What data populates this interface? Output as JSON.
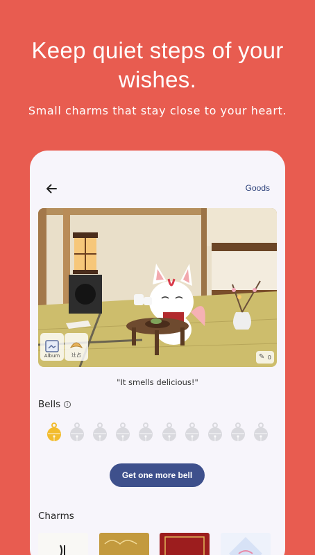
{
  "promo": {
    "headline_line1": "Keep quiet steps of your",
    "headline_line2": "wishes.",
    "subline": "Small charms that stay close to your heart."
  },
  "app": {
    "back_icon": "arrow-left-icon",
    "goods_label": "Goods",
    "scene": {
      "album_label": "Album",
      "fortune_label": "辻占",
      "counter_value": "0"
    },
    "quote": "\"It smells delicious!\"",
    "bells": {
      "title": "Bells",
      "info_icon": "info-icon",
      "total": 10,
      "filled": 1,
      "filled_color": "#f2bc2e",
      "empty_color": "#d9d9de"
    },
    "more_bell_button": "Get one more bell",
    "charms_title": "Charms"
  },
  "colors": {
    "background": "#e85c50",
    "button": "#3e508c",
    "link": "#2b3f79"
  }
}
